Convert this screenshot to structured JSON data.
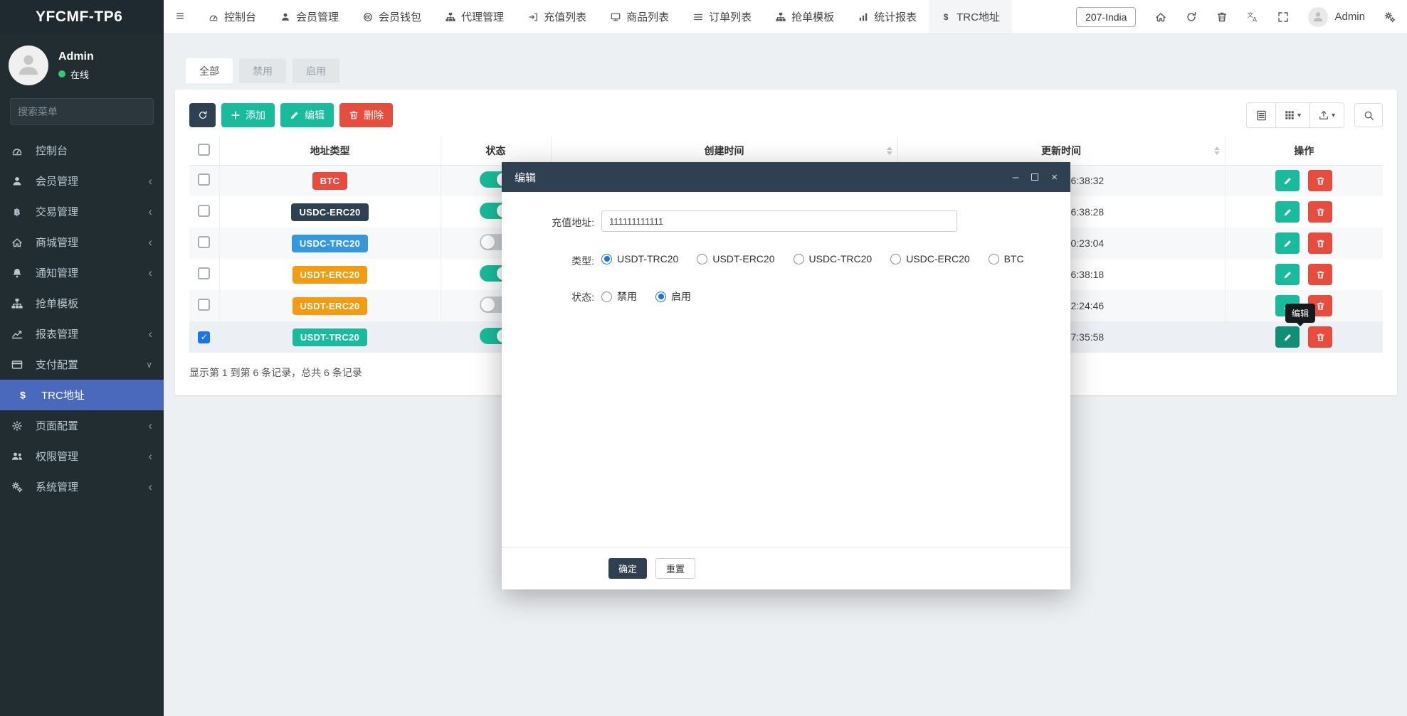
{
  "brand": "YFCMF-TP6",
  "user": {
    "name": "Admin",
    "status": "在线"
  },
  "sidebar": {
    "search_placeholder": "搜索菜单",
    "items": [
      {
        "key": "dashboard",
        "label": "控制台",
        "icon": "speedometer",
        "chevron": ""
      },
      {
        "key": "member-mgmt",
        "label": "会员管理",
        "icon": "user",
        "chevron": "left"
      },
      {
        "key": "trade-mgmt",
        "label": "交易管理",
        "icon": "bitcoin",
        "chevron": "left"
      },
      {
        "key": "mall-mgmt",
        "label": "商城管理",
        "icon": "home",
        "chevron": "left"
      },
      {
        "key": "notice-mgmt",
        "label": "通知管理",
        "icon": "bell",
        "chevron": "left"
      },
      {
        "key": "order-grab-template",
        "label": "抢单模板",
        "icon": "sitemap",
        "chevron": ""
      },
      {
        "key": "report-mgmt",
        "label": "报表管理",
        "icon": "chartline",
        "chevron": "left"
      },
      {
        "key": "payment-config",
        "label": "支付配置",
        "icon": "card",
        "chevron": "down"
      },
      {
        "key": "trc-address",
        "label": "TRC地址",
        "icon": "dollar",
        "chevron": "",
        "active": true,
        "sub": true
      },
      {
        "key": "page-config",
        "label": "页面配置",
        "icon": "gear",
        "chevron": "left"
      },
      {
        "key": "permission-mgmt",
        "label": "权限管理",
        "icon": "users",
        "chevron": "left"
      },
      {
        "key": "system-mgmt",
        "label": "系统管理",
        "icon": "gears",
        "chevron": "left"
      }
    ]
  },
  "topnav": {
    "items": [
      {
        "key": "dashboard",
        "label": "控制台",
        "icon": "speedometer"
      },
      {
        "key": "member-mgmt",
        "label": "会员管理",
        "icon": "user"
      },
      {
        "key": "member-wallet",
        "label": "会员钱包",
        "icon": "wallet"
      },
      {
        "key": "agent-mgmt",
        "label": "代理管理",
        "icon": "sitemap"
      },
      {
        "key": "deposit-list",
        "label": "充值列表",
        "icon": "deposit"
      },
      {
        "key": "product-list",
        "label": "商品列表",
        "icon": "monitor"
      },
      {
        "key": "order-list",
        "label": "订单列表",
        "icon": "list"
      },
      {
        "key": "grab-template",
        "label": "抢单模板",
        "icon": "sitemap"
      },
      {
        "key": "stats-report",
        "label": "统计报表",
        "icon": "bars"
      },
      {
        "key": "trc-address",
        "label": "TRC地址",
        "icon": "dollar",
        "active": true
      }
    ],
    "right": {
      "region": "207-India",
      "user": "Admin",
      "icons": [
        "home",
        "refresh",
        "trash",
        "translate",
        "expand",
        "gears"
      ]
    }
  },
  "tabs": [
    {
      "key": "all",
      "label": "全部",
      "active": true
    },
    {
      "key": "disabled",
      "label": "禁用"
    },
    {
      "key": "enabled",
      "label": "启用"
    }
  ],
  "toolbar": {
    "add_label": "添加",
    "edit_label": "编辑",
    "delete_label": "删除"
  },
  "table": {
    "headers": {
      "address_type": "地址类型",
      "status": "状态",
      "created": "创建时间",
      "updated": "更新时间",
      "actions": "操作"
    },
    "rows": [
      {
        "type": "BTC",
        "badge_color": "#e74c3c",
        "status_on": true,
        "updated_visible": "6:38:32"
      },
      {
        "type": "USDC-ERC20",
        "badge_color": "#2f4050",
        "status_on": true,
        "updated_visible": "6:38:28"
      },
      {
        "type": "USDC-TRC20",
        "badge_color": "#3498db",
        "status_on": false,
        "updated_visible": "0:23:04"
      },
      {
        "type": "USDT-ERC20",
        "badge_color": "#f39c12",
        "status_on": true,
        "updated_visible": "6:38:18"
      },
      {
        "type": "USDT-ERC20",
        "badge_color": "#f39c12",
        "status_on": false,
        "updated_visible": "2:24:46"
      },
      {
        "type": "USDT-TRC20",
        "badge_color": "#18bc9c",
        "status_on": true,
        "updated_visible": "7:35:58",
        "checked": true,
        "selected": true,
        "edit_hovered": true
      }
    ],
    "summary": "显示第 1 到第 6 条记录，总共 6 条记录"
  },
  "modal": {
    "title": "编辑",
    "window_icons": [
      "minimize",
      "maximize",
      "close"
    ],
    "fields": {
      "address_label": "充值地址:",
      "address_value": "111111111111",
      "type_label": "类型:",
      "type_options": [
        {
          "key": "usdt-trc20",
          "label": "USDT-TRC20",
          "selected": true
        },
        {
          "key": "usdt-erc20",
          "label": "USDT-ERC20"
        },
        {
          "key": "usdc-trc20",
          "label": "USDC-TRC20"
        },
        {
          "key": "usdc-erc20",
          "label": "USDC-ERC20"
        },
        {
          "key": "btc",
          "label": "BTC"
        }
      ],
      "status_label": "状态:",
      "status_options": [
        {
          "key": "disabled",
          "label": "禁用"
        },
        {
          "key": "enabled",
          "label": "启用",
          "selected": true
        }
      ]
    },
    "confirm_label": "确定",
    "reset_label": "重置"
  },
  "tooltip": "编辑",
  "colors": {
    "accent_green": "#18bc9c",
    "accent_red": "#e74c3c",
    "navy": "#2f4050",
    "badge_blue": "#3498db",
    "badge_orange": "#f39c12",
    "sidebar_active": "#4a69bd",
    "check_blue": "#1a73e8"
  }
}
